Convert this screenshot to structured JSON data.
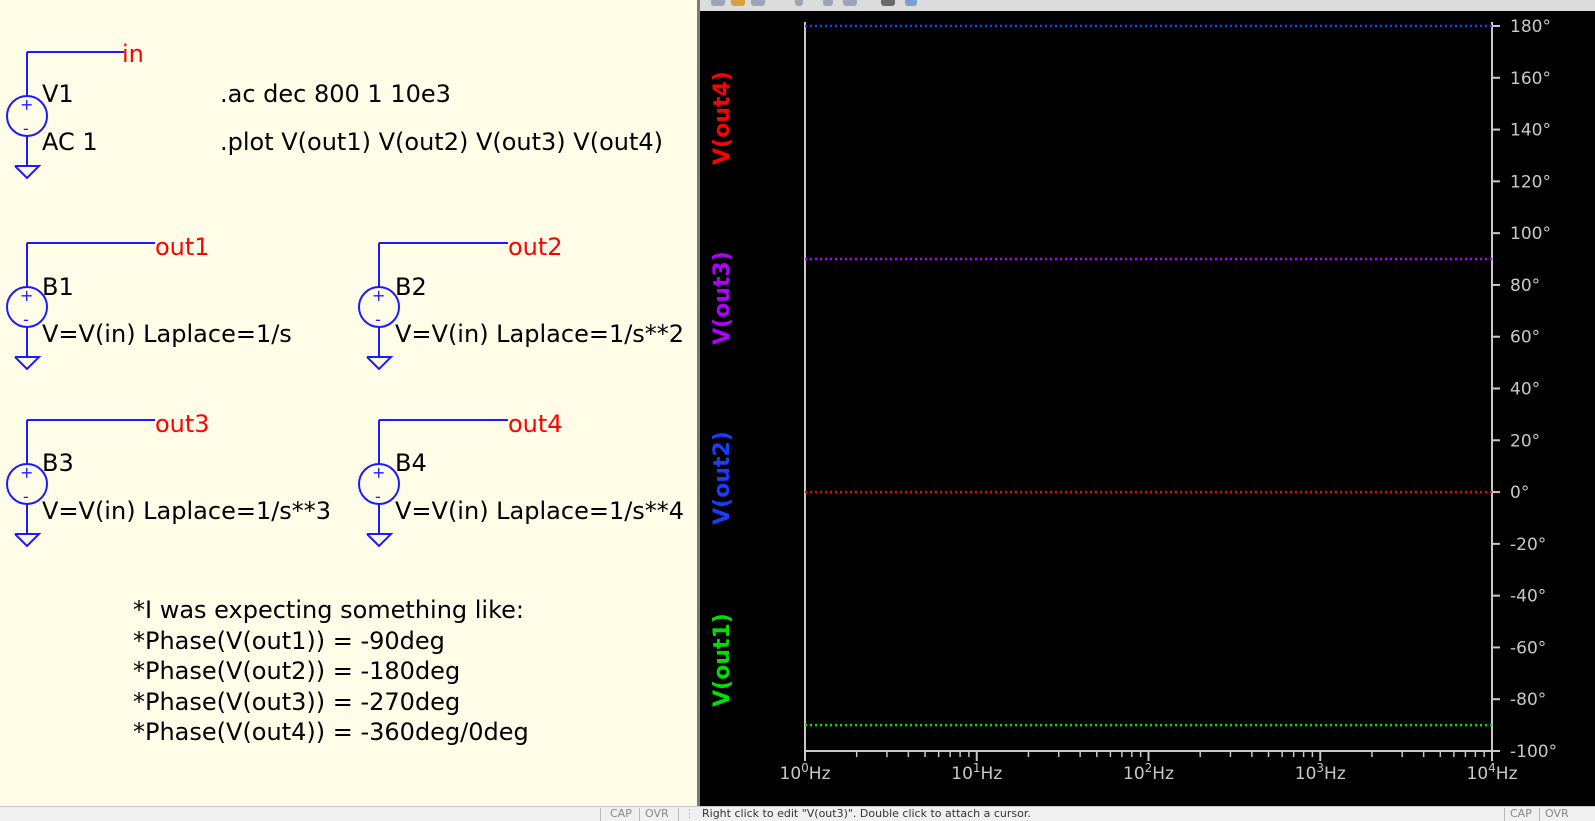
{
  "schematic": {
    "nets": {
      "in": "in",
      "out1": "out1",
      "out2": "out2",
      "out3": "out3",
      "out4": "out4"
    },
    "sources": [
      {
        "name": "V1",
        "value": "AC 1"
      },
      {
        "name": "B1",
        "value": "V=V(in) Laplace=1/s"
      },
      {
        "name": "B2",
        "value": "V=V(in) Laplace=1/s**2"
      },
      {
        "name": "B3",
        "value": "V=V(in) Laplace=1/s**3"
      },
      {
        "name": "B4",
        "value": "V=V(in) Laplace=1/s**4"
      }
    ],
    "directives": [
      ".ac dec 800 1 10e3",
      ".plot V(out1) V(out2) V(out3) V(out4)"
    ],
    "comment_lines": [
      "*I was expecting something like:",
      "*Phase(V(out1)) = -90deg",
      "*Phase(V(out2)) = -180deg",
      "*Phase(V(out3)) = -270deg",
      "*Phase(V(out4)) = -360deg/0deg"
    ],
    "source_symbol": {
      "plus": "+",
      "minus": "-"
    }
  },
  "statusbar": {
    "left_cap": "CAP",
    "left_ovr": "OVR",
    "right_message": "Right click to edit \"V(out3)\".  Double click to attach a cursor.",
    "right_cap": "CAP",
    "right_ovr": "OVR"
  },
  "chart_data": {
    "type": "line",
    "x_scale": "log",
    "xlim": [
      1,
      10000
    ],
    "ylim": [
      -100,
      180
    ],
    "x_ticks": [
      {
        "base": "10",
        "exp": "0",
        "unit": "Hz",
        "value": 1
      },
      {
        "base": "10",
        "exp": "1",
        "unit": "Hz",
        "value": 10
      },
      {
        "base": "10",
        "exp": "2",
        "unit": "Hz",
        "value": 100
      },
      {
        "base": "10",
        "exp": "3",
        "unit": "Hz",
        "value": 1000
      },
      {
        "base": "10",
        "exp": "4",
        "unit": "Hz",
        "value": 10000
      }
    ],
    "y_ticks": [
      "180°",
      "160°",
      "140°",
      "120°",
      "100°",
      "80°",
      "60°",
      "40°",
      "20°",
      "0°",
      "-20°",
      "-40°",
      "-60°",
      "-80°",
      "-100°"
    ],
    "y_tick_values": [
      180,
      160,
      140,
      120,
      100,
      80,
      60,
      40,
      20,
      0,
      -20,
      -40,
      -60,
      -80,
      -100
    ],
    "series": [
      {
        "name": "V(out1)",
        "color": "#00e000",
        "x": [
          1,
          10000
        ],
        "phase": [
          -90,
          -90
        ]
      },
      {
        "name": "V(out2)",
        "color": "#1a3cff",
        "x": [
          1,
          10000
        ],
        "phase": [
          180,
          180
        ]
      },
      {
        "name": "V(out3)",
        "color": "#b000ff",
        "x": [
          1,
          10000
        ],
        "phase": [
          90,
          90
        ]
      },
      {
        "name": "V(out4)",
        "color": "#ff0000",
        "x": [
          1,
          10000
        ],
        "phase": [
          0,
          0
        ]
      }
    ],
    "grid": false,
    "legend_placement": "left-vertical"
  }
}
